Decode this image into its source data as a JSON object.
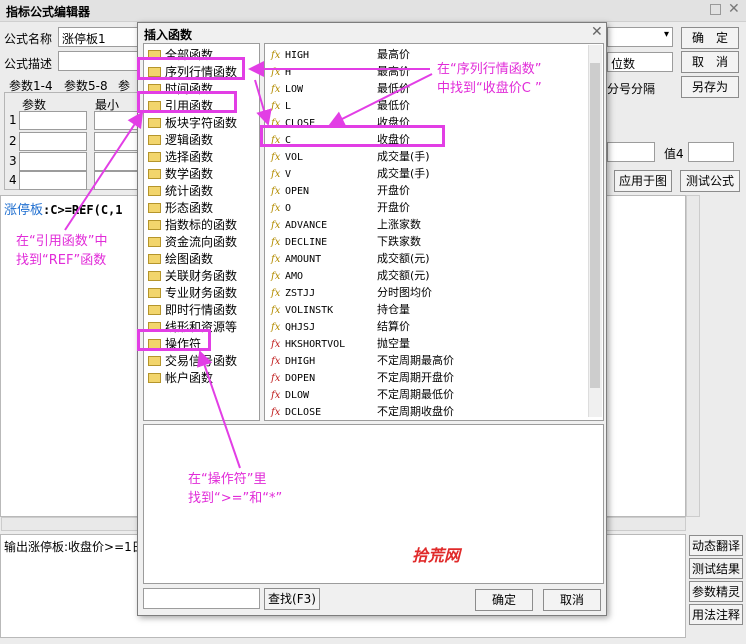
{
  "window": {
    "title": "指标公式编辑器"
  },
  "form": {
    "name_label": "公式名称",
    "name_value": "涨停板1",
    "desc_label": "公式描述",
    "tabs": [
      "参数1-4",
      "参数5-8",
      "参"
    ],
    "params_header": [
      "参数",
      "最小"
    ],
    "param_rows": [
      "1",
      "2",
      "3",
      "4"
    ],
    "right_dropdown": "位数",
    "separator_text": "分号分隔",
    "value4_label": "值4",
    "buttons": {
      "confirm": "确　定",
      "cancel": "取　消",
      "save_as": "另存为",
      "apply": "应用于图",
      "test": "测试公式"
    }
  },
  "editor": {
    "code_name": "涨停板",
    "code_rest": ":C>=REF(C,1"
  },
  "output": {
    "text": "输出涨停板:收盘价>=1日"
  },
  "side_buttons": [
    "动态翻译",
    "测试结果",
    "参数精灵",
    "用法注释"
  ],
  "dialog": {
    "title": "插入函数",
    "categories": [
      "全部函数",
      "序列行情函数",
      "时间函数",
      "引用函数",
      "板块字符函数",
      "逻辑函数",
      "选择函数",
      "数学函数",
      "统计函数",
      "形态函数",
      "指数标的函数",
      "资金流向函数",
      "绘图函数",
      "关联财务函数",
      "专业财务函数",
      "即时行情函数",
      "线形和资源等",
      "操作符",
      "交易信号函数",
      "帐户函数"
    ],
    "functions": [
      {
        "name": "HIGH",
        "desc": "最高价"
      },
      {
        "name": "H",
        "desc": "最高价"
      },
      {
        "name": "LOW",
        "desc": "最低价"
      },
      {
        "name": "L",
        "desc": "最低价"
      },
      {
        "name": "CLOSE",
        "desc": "收盘价"
      },
      {
        "name": "C",
        "desc": "收盘价"
      },
      {
        "name": "VOL",
        "desc": "成交量(手)"
      },
      {
        "name": "V",
        "desc": "成交量(手)"
      },
      {
        "name": "OPEN",
        "desc": "开盘价"
      },
      {
        "name": "O",
        "desc": "开盘价"
      },
      {
        "name": "ADVANCE",
        "desc": "上涨家数"
      },
      {
        "name": "DECLINE",
        "desc": "下跌家数"
      },
      {
        "name": "AMOUNT",
        "desc": "成交额(元)"
      },
      {
        "name": "AMO",
        "desc": "成交额(元)"
      },
      {
        "name": "ZSTJJ",
        "desc": "分时图均价"
      },
      {
        "name": "VOLINSTK",
        "desc": "持仓量"
      },
      {
        "name": "QHJSJ",
        "desc": "结算价"
      },
      {
        "name": "HKSHORTVOL",
        "desc": "抛空量"
      },
      {
        "name": "DHIGH",
        "desc": "不定周期最高价"
      },
      {
        "name": "DOPEN",
        "desc": "不定周期开盘价"
      },
      {
        "name": "DLOW",
        "desc": "不定周期最低价"
      },
      {
        "name": "DCLOSE",
        "desc": "不定周期收盘价"
      }
    ],
    "fx_label": "fx",
    "search_button": "查找(F3)",
    "ok_button": "确定",
    "cancel_button": "取消"
  },
  "annotations": {
    "a1_line1": "在“序列行情函数”",
    "a1_line2": "中找到“收盘价C ”",
    "a2_line1": "在“引用函数”中",
    "a2_line2": "找到“REF”函数",
    "a3_line1": "在“操作符”里",
    "a3_line2": "找到“>=”和“*”",
    "watermark": "拾荒网"
  },
  "colors": {
    "highlight": "#e23ee5",
    "annotation": "#e12bd8",
    "code_name": "#1f6fd0"
  }
}
